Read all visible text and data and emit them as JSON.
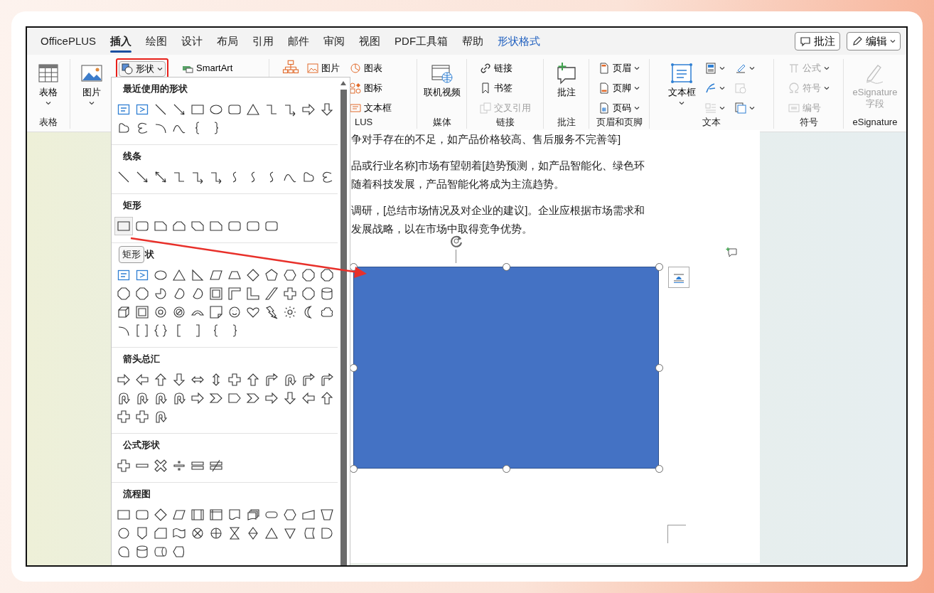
{
  "tabs": [
    {
      "label": "OfficePLUS",
      "selected": false,
      "contextual": false
    },
    {
      "label": "插入",
      "selected": true,
      "contextual": false
    },
    {
      "label": "绘图",
      "selected": false,
      "contextual": false
    },
    {
      "label": "设计",
      "selected": false,
      "contextual": false
    },
    {
      "label": "布局",
      "selected": false,
      "contextual": false
    },
    {
      "label": "引用",
      "selected": false,
      "contextual": false
    },
    {
      "label": "邮件",
      "selected": false,
      "contextual": false
    },
    {
      "label": "审阅",
      "selected": false,
      "contextual": false
    },
    {
      "label": "视图",
      "selected": false,
      "contextual": false
    },
    {
      "label": "PDF工具箱",
      "selected": false,
      "contextual": false
    },
    {
      "label": "帮助",
      "selected": false,
      "contextual": false
    },
    {
      "label": "形状格式",
      "selected": false,
      "contextual": true
    }
  ],
  "top_buttons": [
    {
      "label": "批注",
      "dropdown": false
    },
    {
      "label": "编辑",
      "dropdown": true
    }
  ],
  "ribbon": [
    {
      "label": "表格",
      "columns": [
        [
          {
            "kind": "large",
            "label": "表格",
            "dropdown": true,
            "disabled": false
          }
        ]
      ]
    },
    {
      "columns": [
        [
          {
            "kind": "large",
            "label": "图片",
            "dropdown": true,
            "disabled": false
          }
        ],
        [
          {
            "kind": "small",
            "label": "形状",
            "dropdown": true,
            "disabled": false,
            "highlighted": true
          }
        ],
        [
          {
            "kind": "small",
            "label": "SmartArt",
            "dropdown": false,
            "disabled": false
          }
        ]
      ]
    },
    {
      "label": "LUS",
      "columns": [
        [
          {
            "kind": "large",
            "dropdown": false,
            "disabled": false
          }
        ],
        [
          {
            "kind": "small",
            "label": "图片",
            "dropdown": false,
            "disabled": false
          }
        ],
        [
          {
            "kind": "small",
            "label": "图表",
            "dropdown": false,
            "disabled": false
          },
          {
            "kind": "small",
            "label": "图标",
            "dropdown": false,
            "disabled": false
          },
          {
            "kind": "small",
            "label": "文本框",
            "dropdown": false,
            "disabled": false
          }
        ]
      ]
    },
    {
      "label": "媒体",
      "columns": [
        [
          {
            "kind": "large",
            "label": "联机视频",
            "dropdown": false,
            "disabled": false
          }
        ]
      ]
    },
    {
      "label": "链接",
      "columns": [
        [
          {
            "kind": "small",
            "label": "链接",
            "dropdown": false,
            "disabled": false
          },
          {
            "kind": "small",
            "label": "书签",
            "dropdown": false,
            "disabled": false
          },
          {
            "kind": "small",
            "label": "交叉引用",
            "dropdown": false,
            "disabled": true
          }
        ]
      ]
    },
    {
      "label": "批注",
      "columns": [
        [
          {
            "kind": "large",
            "label": "批注",
            "dropdown": false,
            "disabled": false
          }
        ]
      ]
    },
    {
      "label": "页眉和页脚",
      "columns": [
        [
          {
            "kind": "small",
            "label": "页眉",
            "dropdown": true,
            "disabled": false
          },
          {
            "kind": "small",
            "label": "页脚",
            "dropdown": true,
            "disabled": false
          },
          {
            "kind": "small",
            "label": "页码",
            "dropdown": true,
            "disabled": false
          }
        ]
      ]
    },
    {
      "label": "文本",
      "columns": [
        [
          {
            "kind": "large",
            "label": "文本框",
            "dropdown": true,
            "disabled": false
          }
        ],
        [
          {
            "kind": "small",
            "dropdown": true,
            "disabled": false
          },
          {
            "kind": "small",
            "dropdown": true,
            "disabled": false
          },
          {
            "kind": "small",
            "dropdown": true,
            "disabled": true
          }
        ],
        [
          {
            "kind": "small",
            "dropdown": true,
            "disabled": false
          },
          {
            "kind": "small",
            "dropdown": false,
            "disabled": true
          },
          {
            "kind": "small",
            "dropdown": true,
            "disabled": false
          }
        ]
      ]
    },
    {
      "label": "符号",
      "columns": [
        [
          {
            "kind": "small",
            "label": "公式",
            "dropdown": true,
            "disabled": true
          },
          {
            "kind": "small",
            "label": "符号",
            "dropdown": true,
            "disabled": true
          },
          {
            "kind": "small",
            "label": "编号",
            "dropdown": false,
            "disabled": true
          }
        ]
      ]
    },
    {
      "label": "eSignature",
      "columns": [
        [
          {
            "kind": "large",
            "label": "eSignature 字段",
            "dropdown": false,
            "disabled": true
          }
        ]
      ]
    }
  ],
  "shapes_panel": {
    "sections": [
      {
        "title": "最近使用的形状",
        "first_hovered": false
      },
      {
        "title": "线条",
        "first_hovered": false
      },
      {
        "title": "矩形",
        "first_hovered": true
      },
      {
        "title": "状",
        "tooltip": "矩形",
        "first_hovered": false
      },
      {
        "title": "箭头总汇",
        "first_hovered": false
      },
      {
        "title": "公式形状",
        "first_hovered": false
      },
      {
        "title": "流程图",
        "first_hovered": false
      }
    ]
  },
  "document": {
    "paragraphs": [
      [
        "争对手存在的不足，如产品价格较高、售后服务不完善等]"
      ],
      [
        "品或行业名称]市场有望朝着[趋势预测，如产品智能化、绿色环",
        "随着科技发展，产品智能化将成为主流趋势。"
      ],
      [
        "调研，[总结市场情况及对企业的建议]。企业应根据市场需求和",
        "发展战略，以在市场中取得竞争优势。"
      ]
    ]
  },
  "canvas_shape": {
    "selected": true,
    "color": "#4472c4"
  }
}
